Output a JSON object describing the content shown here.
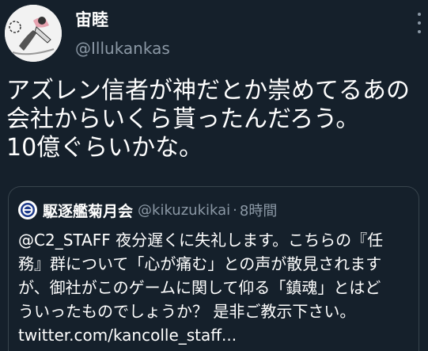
{
  "author": {
    "display_name": "宙睦",
    "username": "@Illukankas"
  },
  "tweet": {
    "lines": [
      "アズレン信者が神だとか崇めてるあの",
      "会社からいくら貰ったんだろう。",
      "10億ぐらいかな。"
    ]
  },
  "quote": {
    "display_name": "駆逐艦菊月会",
    "username": "@kikuzukikai",
    "separator": "·",
    "time": "8時間",
    "lines": [
      "@C2_STAFF 夜分遅くに失礼します。こちらの『任",
      "務』群について「心が痛む」との声が散見されます",
      "が、御社がこのゲームに関して仰る「鎮魂」とはど",
      "ういったものでしょうか？ 是非ご教示下さい。"
    ],
    "link": "twitter.com/kancolle_staff..."
  },
  "icons": {
    "more": "more-options-icon",
    "avatar": "user-avatar",
    "quote_avatar": "emblem-avatar"
  },
  "colors": {
    "background": "#15202b",
    "secondary_text": "#8b98a5",
    "border": "#38444d"
  }
}
